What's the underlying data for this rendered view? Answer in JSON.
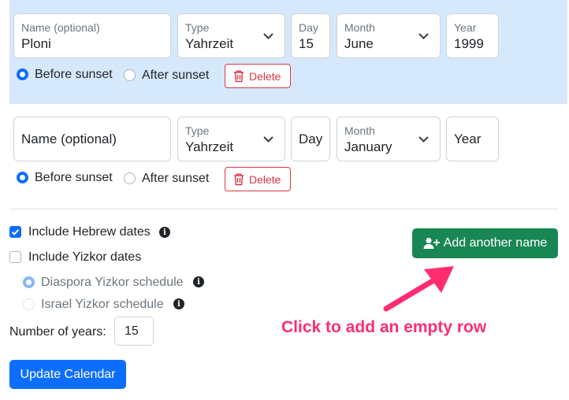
{
  "rows": [
    {
      "name_label": "Name (optional)",
      "name_value": "Ploni",
      "type_label": "Type",
      "type_value": "Yahrzeit",
      "day_label": "Day",
      "day_value": "15",
      "month_label": "Month",
      "month_value": "June",
      "year_label": "Year",
      "year_value": "1999",
      "before_sunset": "Before sunset",
      "after_sunset": "After sunset",
      "delete": "Delete"
    },
    {
      "name_placeholder": "Name (optional)",
      "type_label": "Type",
      "type_value": "Yahrzeit",
      "day_placeholder": "Day",
      "month_label": "Month",
      "month_value": "January",
      "year_placeholder": "Year",
      "before_sunset": "Before sunset",
      "after_sunset": "After sunset",
      "delete": "Delete"
    }
  ],
  "options": {
    "include_hebrew": "Include Hebrew dates",
    "include_yizkor": "Include Yizkor dates",
    "diaspora": "Diaspora Yizkor schedule",
    "israel": "Israel Yizkor schedule",
    "years_label": "Number of years:",
    "years_value": "15"
  },
  "buttons": {
    "add_name": "Add another name",
    "update": "Update Calendar"
  },
  "annotation": "Click to add an empty row",
  "colors": {
    "primary": "#0d6efd",
    "success": "#198754",
    "danger": "#dc3545",
    "highlight_row": "#d6e8fb",
    "annotation": "#ff2d6f"
  },
  "icons": {
    "info": "info-icon",
    "trash": "trash-icon",
    "add_user": "person-plus-icon",
    "chevron": "chevron-down-icon",
    "arrow": "arrow-annotation-icon"
  }
}
